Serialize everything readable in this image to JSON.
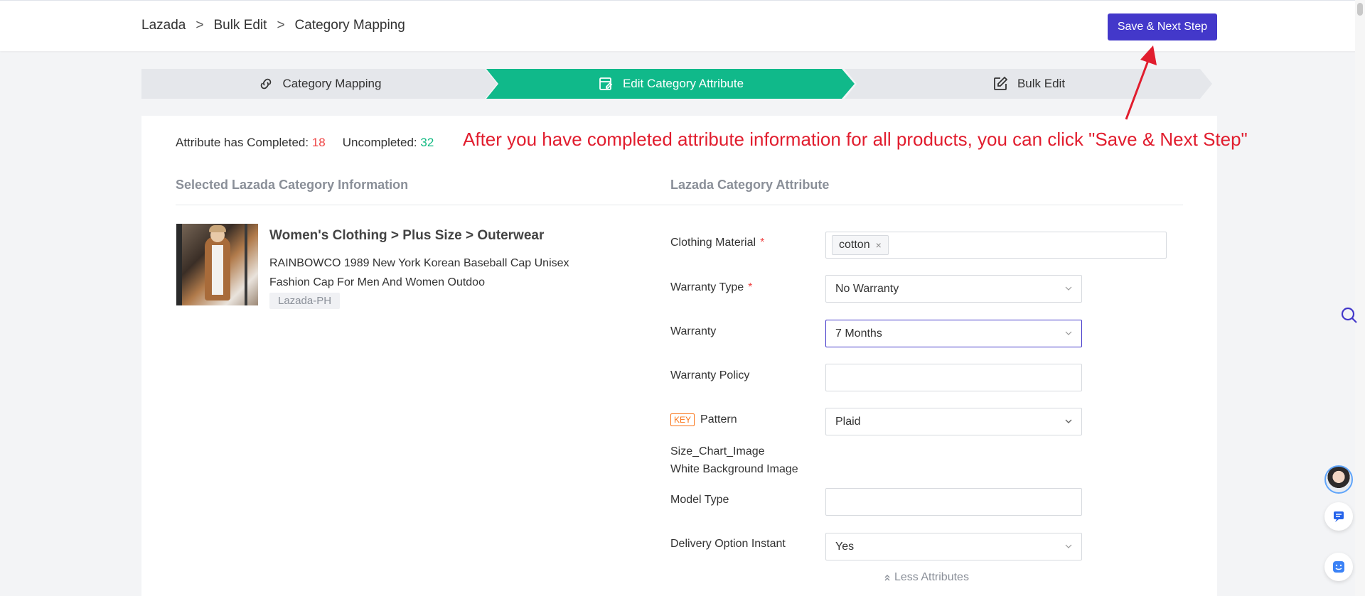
{
  "breadcrumb": {
    "items": [
      "Lazada",
      "Bulk Edit",
      "Category Mapping"
    ],
    "separator": ">"
  },
  "header": {
    "save_label": "Save & Next Step"
  },
  "steps": [
    {
      "label": "Category Mapping",
      "icon": "link-icon",
      "active": false
    },
    {
      "label": "Edit Category Attribute",
      "icon": "edit-list-icon",
      "active": true
    },
    {
      "label": "Bulk Edit",
      "icon": "edit-pen-icon",
      "active": false
    }
  ],
  "counts": {
    "completed_label": "Attribute has Completed:",
    "completed_value": "18",
    "uncompleted_label": "Uncompleted:",
    "uncompleted_value": "32"
  },
  "annotation": "After you have completed attribute information for all products, you can click \"Save & Next Step\"",
  "left_section": {
    "title": "Selected Lazada Category Information",
    "category_path": "Women's Clothing > Plus Size > Outerwear",
    "product_name": "RAINBOWCO 1989 New York Korean Baseball Cap Unisex Fashion Cap For Men And Women Outdoo",
    "tag": "Lazada-PH"
  },
  "right_section": {
    "title": "Lazada Category Attribute",
    "attributes": {
      "clothing_material": {
        "label": "Clothing Material",
        "required_mark": "*",
        "chip": "cotton",
        "chip_remove": "×"
      },
      "warranty_type": {
        "label": "Warranty Type",
        "required_mark": "*",
        "value": "No Warranty"
      },
      "warranty": {
        "label": "Warranty",
        "value": "7 Months"
      },
      "warranty_policy": {
        "label": "Warranty Policy",
        "value": ""
      },
      "pattern": {
        "key_badge": "KEY",
        "label": "Pattern",
        "value": "Plaid"
      },
      "size_chart_image": {
        "label": "Size_Chart_Image"
      },
      "white_background_image": {
        "label": "White Background Image"
      },
      "model_type": {
        "label": "Model Type",
        "value": ""
      },
      "delivery_option_instant": {
        "label": "Delivery Option Instant",
        "value": "Yes"
      }
    },
    "less_attributes": "Less Attributes"
  },
  "colors": {
    "primary": "#4338ca",
    "active_step": "#10b98a",
    "inactive_step": "#e5e7eb",
    "completed": "#ef4444",
    "uncompleted": "#10b981",
    "annotation": "#e11d2e"
  }
}
